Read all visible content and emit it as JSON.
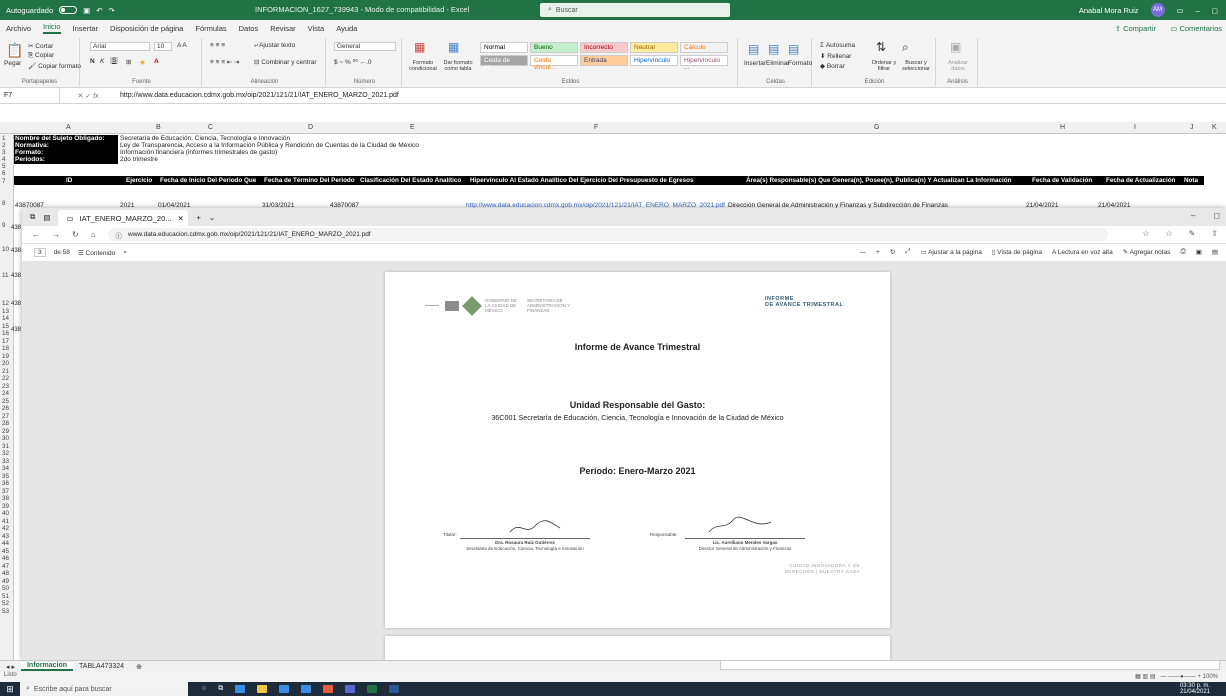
{
  "excel": {
    "autosave": "Autoguardado",
    "title": "INFORMACION_1627_739943 - Modo de compatibilidad - Excel",
    "search_placeholder": "Buscar",
    "user": "Anabal Mora Ruiz",
    "user_initials": "AM",
    "tabs": [
      "Archivo",
      "Inicio",
      "Insertar",
      "Disposición de página",
      "Fórmulas",
      "Datos",
      "Revisar",
      "Vista",
      "Ayuda"
    ],
    "active_tab": "Inicio",
    "share": "Compartir",
    "comments": "Comentarios",
    "ribbon": {
      "clipboard": {
        "paste": "Pegar",
        "cut": "Cortar",
        "copy": "Copiar",
        "copy_format": "Copiar formato",
        "name": "Portapapeles"
      },
      "font": {
        "family": "Arial",
        "size": "10",
        "name": "Fuente"
      },
      "alignment": {
        "wrap": "Ajustar texto",
        "merge": "Combinar y centrar",
        "name": "Alineación"
      },
      "number": {
        "format": "General",
        "name": "Número"
      },
      "styles": {
        "cond": "Formato condicional",
        "table": "Dar formato como tabla",
        "items": [
          {
            "label": "Normal",
            "bg": "#ffffff",
            "fg": "#000000"
          },
          {
            "label": "Bueno",
            "bg": "#c6efce",
            "fg": "#006100"
          },
          {
            "label": "Incorrecto",
            "bg": "#ffc7ce",
            "fg": "#9c0006"
          },
          {
            "label": "Neutral",
            "bg": "#ffeb9c",
            "fg": "#9c6500"
          },
          {
            "label": "Cálculo",
            "bg": "#f2f2f2",
            "fg": "#fa7d00"
          },
          {
            "label": "Celda de co...",
            "bg": "#a5a5a5",
            "fg": "#ffffff"
          },
          {
            "label": "Celda vincul...",
            "bg": "#ffffff",
            "fg": "#fa7d00"
          },
          {
            "label": "Entrada",
            "bg": "#ffcc99",
            "fg": "#3f3f76"
          },
          {
            "label": "Hipervínculo",
            "bg": "#ffffff",
            "fg": "#0563c1"
          },
          {
            "label": "Hipervínculo ...",
            "bg": "#ffffff",
            "fg": "#954f72"
          }
        ],
        "name": "Estilos"
      },
      "cells": {
        "insert": "Insertar",
        "delete": "Eliminar",
        "format": "Formato",
        "name": "Celdas"
      },
      "edit": {
        "autosum": "Autosuma",
        "fill": "Rellenar",
        "clear": "Borrar",
        "sort": "Ordenar y filtrar",
        "find": "Buscar y seleccionar",
        "name": "Edición"
      },
      "analysis": {
        "analyze": "Analizar datos",
        "name": "Análisis"
      }
    },
    "formula_bar": {
      "cell": "F7",
      "formula": "http://www.data.educacion.cdmx.gob.mx/oip/2021/121/21/IAT_ENERO_MARZO_2021.pdf"
    },
    "columns": [
      "A",
      "B",
      "C",
      "D",
      "E",
      "F",
      "G",
      "H",
      "I",
      "J",
      "K"
    ],
    "meta": [
      {
        "label": "Nombre del Sujeto Obligado:",
        "value": "Secretaría de Educación, Ciencia, Tecnología e Innovación"
      },
      {
        "label": "Normativa:",
        "value": "Ley de Transparencia, Acceso a la Información Pública y Rendición de Cuentas de la Ciudad de México"
      },
      {
        "label": "Formato:",
        "value": "Información financiera (informes trimestrales de gasto)"
      },
      {
        "label": "Periodos:",
        "value": "2do trimestre"
      }
    ],
    "headers": [
      "ID",
      "Ejercicio",
      "Fecha de Inicio Del Periodo Que",
      "Fecha de Término Del Periodo",
      "Clasificación Del Estado Analítico",
      "Hipervínculo Al Estado Analítico Del Ejercicio Del Presupuesto de Egresos",
      "Área(s) Responsable(s) Que Genera(n), Posee(n), Publica(n) Y Actualizan La Información",
      "Fecha de Validación",
      "Fecha de Actualización",
      "Nota"
    ],
    "row7": {
      "id": "43870087",
      "ejercicio": "2021",
      "inicio": "01/04/2021",
      "termino": "31/03/2021",
      "clasificacion": "43870087",
      "link": "http://www.data.educacion.cdmx.gob.mx/oip/2021/121/21/IAT_ENERO_MARZO_2021.pdf",
      "area": "Dirección General de Administración y Finanzas y Subdirección de Finanzas",
      "validacion": "21/04/2021",
      "actualizacion": "21/04/2021"
    },
    "row_numbers": [
      "1",
      "2",
      "3",
      "4",
      "5",
      "6",
      "7",
      "8",
      "9",
      "10",
      "11",
      "12",
      "13",
      "14",
      "15",
      "16",
      "17",
      "18",
      "19",
      "20",
      "21",
      "22",
      "23",
      "24",
      "25",
      "26",
      "27",
      "28",
      "29",
      "30",
      "31",
      "32",
      "33",
      "34",
      "35",
      "36",
      "37",
      "38",
      "39",
      "40",
      "41",
      "42",
      "43",
      "44",
      "45",
      "46",
      "47",
      "48",
      "49",
      "50",
      "51",
      "52",
      "53"
    ],
    "left_ids": [
      "438",
      "438",
      "438",
      "438",
      "438"
    ],
    "sheet_tabs": [
      "Informacion",
      "TABLA473324"
    ],
    "status": "Listo",
    "zoom": "100%"
  },
  "edge": {
    "tab_title": "IAT_ENERO_MARZO_20...",
    "url": "www.data.educacion.cdmx.gob.mx/oip/2021/121/21/IAT_ENERO_MARZO_2021.pdf",
    "page_num": "3",
    "page_total": "de 58",
    "contents": "Contenido",
    "tools": [
      "Ajustar a la página",
      "Vista de página",
      "Lectura en voz alta",
      "Agregar notas"
    ]
  },
  "pdf": {
    "logo_text_1": "GOBIERNO DE LA CIUDAD DE MÉXICO",
    "logo_text_2": "SECRETARÍA DE ADMINISTRACIÓN Y FINANZAS",
    "header_right_1": "INFORME",
    "header_right_2": "DE AVANCE TRIMESTRAL",
    "title": "Informe de Avance Trimestral",
    "unit_label": "Unidad Responsable del Gasto:",
    "unit_value": "36C001 Secretaría de Educación, Ciencia, Tecnología e Innovación de la Ciudad de México",
    "period": "Período: Enero-Marzo 2021",
    "titular_label": "Titular:",
    "titular_name": "Dra. Rosaura Ruiz Gutiérrez",
    "titular_role": "Secretaria de Educación, Ciencia, Tecnología e Innovación",
    "resp_label": "Responsable:",
    "resp_name": "Lic. Aurelliano Mendes Vargas",
    "resp_role": "Director General de Administración y Finanzas",
    "cdmx_1": "CIUDAD INNOVADORA Y DE",
    "cdmx_2": "DERECHOS | NUESTRA CASA"
  },
  "taskbar": {
    "search_placeholder": "Escribe aquí para buscar",
    "time": "03:30 p. m.",
    "date": "21/04/2021"
  }
}
